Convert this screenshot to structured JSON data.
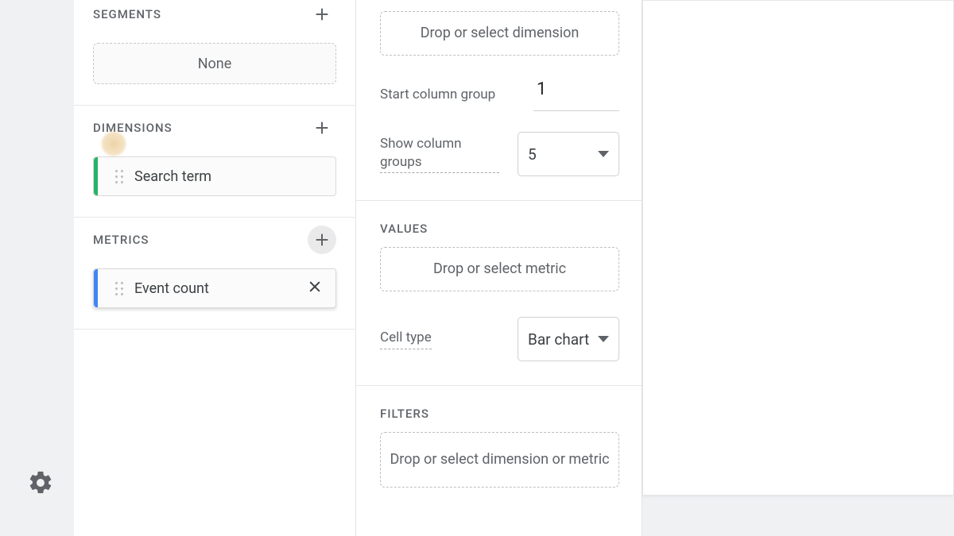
{
  "panel1": {
    "segments": {
      "title": "SEGMENTS",
      "drop_text": "None"
    },
    "dimensions": {
      "title": "DIMENSIONS",
      "chip_label": "Search term"
    },
    "metrics": {
      "title": "METRICS",
      "chip_label": "Event count"
    }
  },
  "panel2": {
    "columns": {
      "drop_text": "Drop or select dimension",
      "start_label": "Start column group",
      "start_value": "1",
      "show_label": "Show column groups",
      "show_value": "5"
    },
    "values": {
      "title": "VALUES",
      "drop_text": "Drop or select metric",
      "cell_type_label": "Cell type",
      "cell_type_value": "Bar chart"
    },
    "filters": {
      "title": "FILTERS",
      "drop_text": "Drop or select dimension or metric"
    }
  }
}
